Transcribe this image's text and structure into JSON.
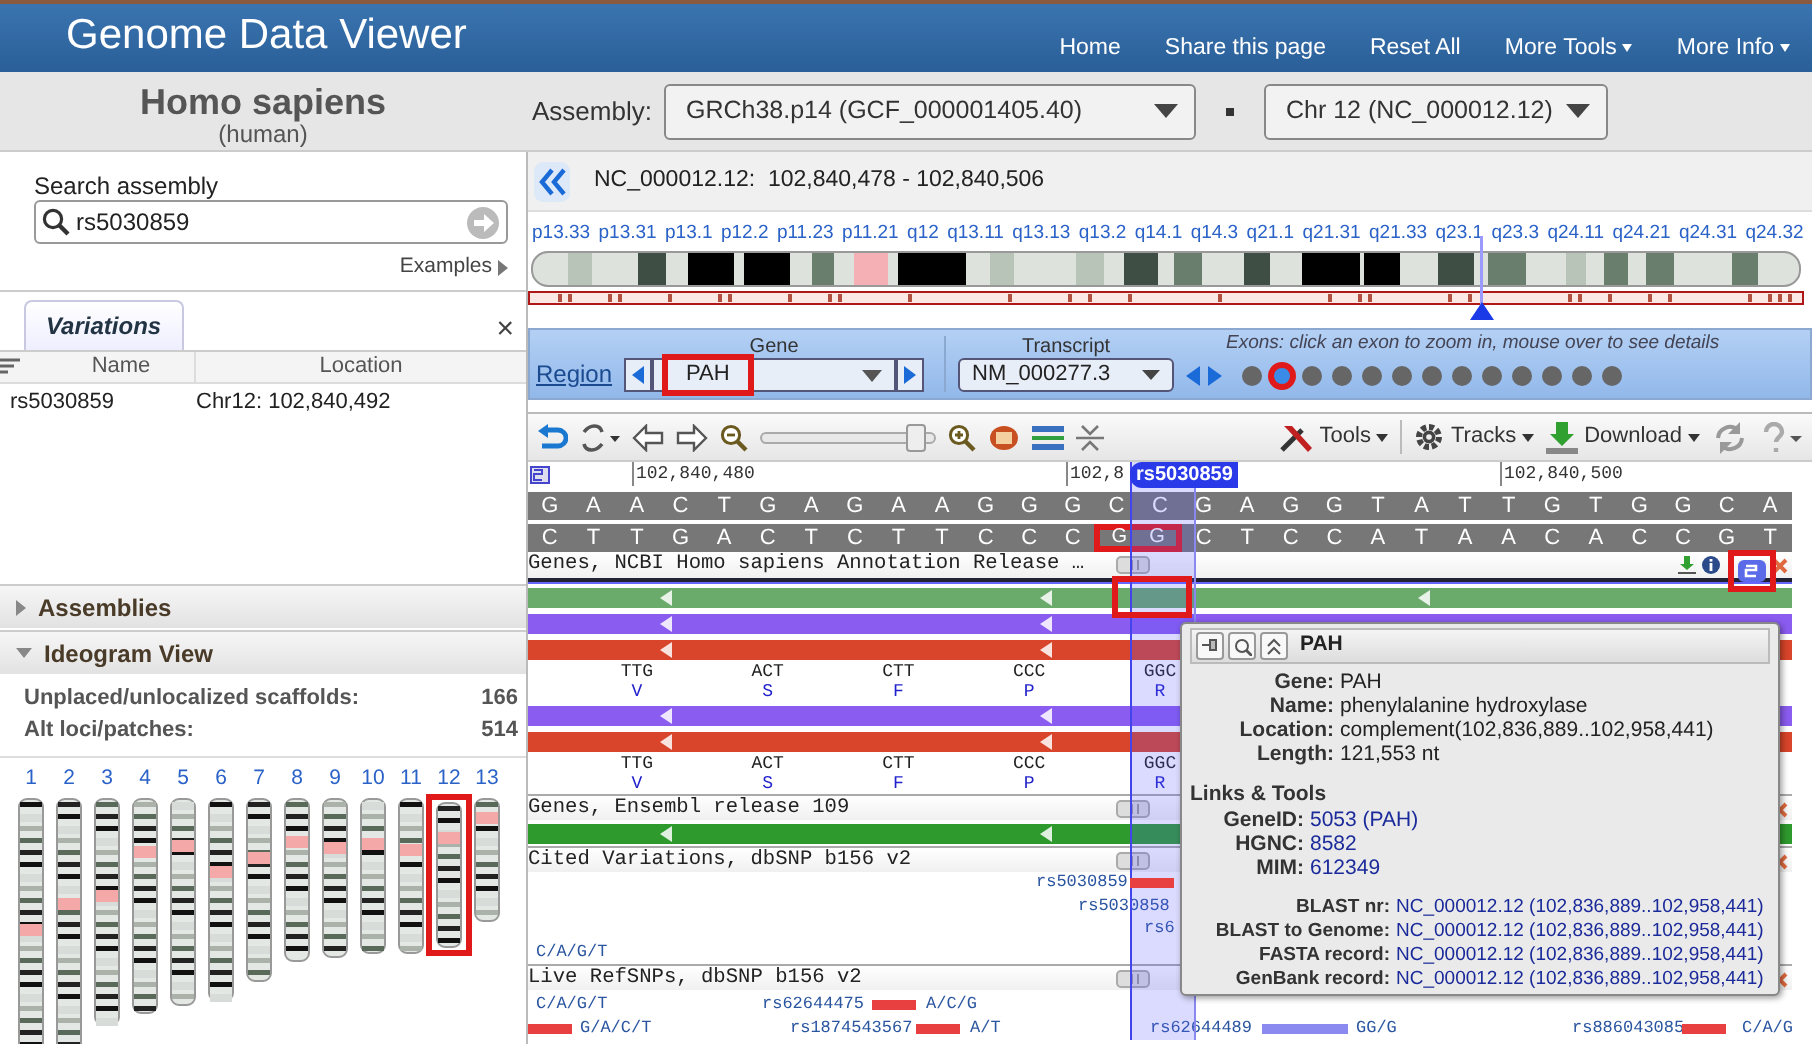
{
  "header": {
    "title": "Genome Data Viewer",
    "nav": [
      {
        "label": "Home",
        "dropdown": false
      },
      {
        "label": "Share this page",
        "dropdown": false
      },
      {
        "label": "Reset All",
        "dropdown": false
      },
      {
        "label": "More Tools",
        "dropdown": true
      },
      {
        "label": "More Info",
        "dropdown": true
      }
    ]
  },
  "organism": {
    "name": "Homo sapiens",
    "common_name": "(human)"
  },
  "assembly": {
    "label": "Assembly:",
    "value": "GRCh38.p14 (GCF_000001405.40)",
    "chromosome": "Chr 12 (NC_000012.12)"
  },
  "search": {
    "label": "Search assembly",
    "value": "rs5030859",
    "examples": "Examples"
  },
  "results_panel": {
    "tab": "Variations",
    "close": "×",
    "columns": [
      "Name",
      "Location"
    ],
    "rows": [
      {
        "name": "rs5030859",
        "location": "Chr12: 102,840,492"
      }
    ]
  },
  "sections": [
    {
      "title": "Assemblies",
      "expanded": false
    },
    {
      "title": "Ideogram View",
      "expanded": true
    }
  ],
  "ideogram_view": {
    "counts": [
      {
        "label": "Unplaced/unlocalized scaffolds:",
        "value": "166"
      },
      {
        "label": "Alt loci/patches:",
        "value": "514"
      }
    ],
    "chromosomes": [
      {
        "label": "1",
        "highlighted": false
      },
      {
        "label": "2",
        "highlighted": false
      },
      {
        "label": "3",
        "highlighted": false
      },
      {
        "label": "4",
        "highlighted": false
      },
      {
        "label": "5",
        "highlighted": false
      },
      {
        "label": "6",
        "highlighted": false
      },
      {
        "label": "7",
        "highlighted": false
      },
      {
        "label": "8",
        "highlighted": false
      },
      {
        "label": "9",
        "highlighted": false
      },
      {
        "label": "10",
        "highlighted": false
      },
      {
        "label": "11",
        "highlighted": false
      },
      {
        "label": "12",
        "highlighted": true
      },
      {
        "label": "13",
        "highlighted": false
      }
    ]
  },
  "location": "NC_000012.12:  102,840,478 - 102,840,506",
  "chromosome_bands": [
    "p13.33",
    "p13.31",
    "p13.1",
    "p12.2",
    "p11.23",
    "p11.21",
    "q12",
    "q13.11",
    "q13.13",
    "q13.2",
    "q14.1",
    "q14.3",
    "q21.1",
    "q21.31",
    "q21.33",
    "q23.1",
    "q23.3",
    "q24.11",
    "q24.21",
    "q24.31",
    "q24.32"
  ],
  "navigation": {
    "region_link": "Region",
    "gene": {
      "label": "Gene",
      "value": "PAH",
      "highlighted": true
    },
    "transcript": {
      "label": "Transcript",
      "value": "NM_000277.3"
    },
    "exons_hint": "Exons: click an exon to zoom in, mouse over to see details",
    "exons": [
      {
        "selected": false
      },
      {
        "selected": true
      },
      {
        "selected": false
      },
      {
        "selected": false
      },
      {
        "selected": false
      },
      {
        "selected": false
      },
      {
        "selected": false
      },
      {
        "selected": false
      },
      {
        "selected": false
      },
      {
        "selected": false
      },
      {
        "selected": false
      },
      {
        "selected": false
      },
      {
        "selected": false
      }
    ]
  },
  "toolbar": {
    "zoom": {
      "level": 0.92
    },
    "menus": [
      {
        "label": "Tools"
      },
      {
        "label": "Tracks"
      },
      {
        "label": "Download"
      }
    ]
  },
  "ruler": {
    "ticks": [
      "102,840,480",
      "102,8",
      "102,840,500"
    ],
    "marker": "rs5030859"
  },
  "sequence": {
    "forward": [
      "G",
      "A",
      "A",
      "C",
      "T",
      "G",
      "A",
      "G",
      "A",
      "A",
      "G",
      "G",
      "G",
      "C",
      "C",
      "G",
      "A",
      "G",
      "G",
      "T",
      "A",
      "T",
      "T",
      "G",
      "T",
      "G",
      "G",
      "C",
      "A"
    ],
    "reverse": [
      {
        "bases": [
          "C",
          "T",
          "T",
          "G",
          "A",
          "C",
          "T",
          "C",
          "T",
          "T",
          "C",
          "C",
          "C"
        ],
        "highlighted": false
      },
      {
        "bases": [
          "G",
          "G"
        ],
        "highlighted": true
      },
      {
        "bases": [
          "C",
          "T",
          "C",
          "C",
          "A",
          "T",
          "A",
          "A",
          "C",
          "A",
          "C",
          "C",
          "G",
          "T"
        ],
        "highlighted": false
      }
    ],
    "strand_toggle": {
      "highlighted": true
    }
  },
  "tracks": [
    {
      "title": "Genes, NCBI Homo sapiens Annotation Release …",
      "actions": true,
      "rows": [
        {
          "kind": "bar",
          "color": "#6aaa6a",
          "highlighted": true
        },
        {
          "kind": "bar",
          "color": "#8a5cf0",
          "highlighted": false
        },
        {
          "kind": "bar",
          "color": "#d8452a",
          "highlighted": false
        },
        {
          "kind": "codons",
          "codons": [
            {
              "codon": "TTG",
              "amino_acid": "V"
            },
            {
              "codon": "ACT",
              "amino_acid": "S"
            },
            {
              "codon": "CTT",
              "amino_acid": "F"
            },
            {
              "codon": "CCC",
              "amino_acid": "P"
            },
            {
              "codon": "GGC",
              "amino_acid": "R"
            }
          ]
        },
        {
          "kind": "bar",
          "color": "#8a5cf0",
          "highlighted": false
        },
        {
          "kind": "bar",
          "color": "#d8452a",
          "highlighted": false
        },
        {
          "kind": "codons",
          "codons": [
            {
              "codon": "TTG",
              "amino_acid": "V"
            },
            {
              "codon": "ACT",
              "amino_acid": "S"
            },
            {
              "codon": "CTT",
              "amino_acid": "F"
            },
            {
              "codon": "CCC",
              "amino_acid": "P"
            },
            {
              "codon": "GGC",
              "amino_acid": "R"
            }
          ]
        }
      ]
    },
    {
      "title": "Genes, Ensembl release 109",
      "rows": [
        {
          "kind": "bar",
          "color": "#2e9a2e",
          "highlighted": false
        }
      ]
    },
    {
      "title": "Cited Variations, dbSNP b156 v2",
      "rows": [
        {
          "kind": "variants",
          "items": [
            {
              "kind": "label",
              "text": "rs5030859"
            },
            {
              "kind": "bar",
              "color": "#e84040"
            }
          ]
        },
        {
          "kind": "variants",
          "items": [
            {
              "kind": "label",
              "text": "rs5030858"
            }
          ]
        },
        {
          "kind": "variants",
          "items": [
            {
              "kind": "label",
              "text": "rs6"
            }
          ]
        },
        {
          "kind": "variants",
          "items": [
            {
              "kind": "label",
              "text": "C/A/G/T"
            }
          ]
        }
      ]
    },
    {
      "title": "Live RefSNPs, dbSNP b156 v2",
      "rows": [
        {
          "kind": "variants",
          "items": [
            {
              "kind": "label",
              "text": "C/A/G/T"
            },
            {
              "kind": "label",
              "text": "rs62644475"
            },
            {
              "kind": "bar",
              "color": "#e84040"
            },
            {
              "kind": "label",
              "text": "A/C/G"
            }
          ]
        },
        {
          "kind": "variants",
          "items": [
            {
              "kind": "bar",
              "color": "#e84040"
            },
            {
              "kind": "label",
              "text": "G/A/C/T"
            },
            {
              "kind": "label",
              "text": "rs1874543567"
            },
            {
              "kind": "bar",
              "color": "#e84040"
            },
            {
              "kind": "label",
              "text": "A/T"
            },
            {
              "kind": "label",
              "text": "rs62644489"
            },
            {
              "kind": "bar",
              "color": "#8a8af0"
            },
            {
              "kind": "label",
              "text": "GG/G"
            },
            {
              "kind": "label",
              "text": "rs886043085"
            },
            {
              "kind": "bar",
              "color": "#e84040"
            },
            {
              "kind": "label",
              "text": "C/A/G"
            }
          ]
        }
      ]
    }
  ],
  "popup": {
    "title": "PAH",
    "fields": [
      {
        "label": "Gene:",
        "value": "PAH"
      },
      {
        "label": "Name:",
        "value": "phenylalanine hydroxylase"
      },
      {
        "label": "Location:",
        "value": "complement(102,836,889..102,958,441)"
      },
      {
        "label": "Length:",
        "value": "121,553 nt"
      }
    ],
    "links_title": "Links & Tools",
    "links": [
      {
        "label": "GeneID:",
        "value": "5053 (PAH)"
      },
      {
        "label": "HGNC:",
        "value": "8582"
      },
      {
        "label": "MIM:",
        "value": "612349"
      }
    ],
    "blast": [
      {
        "label": "BLAST nr:",
        "value": "NC_000012.12 (102,836,889..102,958,441)"
      },
      {
        "label": "BLAST to Genome:",
        "value": "NC_000012.12 (102,836,889..102,958,441)"
      },
      {
        "label": "FASTA record:",
        "value": "NC_000012.12 (102,836,889..102,958,441)"
      },
      {
        "label": "GenBank record:",
        "value": "NC_000012.12 (102,836,889..102,958,441)"
      }
    ]
  }
}
